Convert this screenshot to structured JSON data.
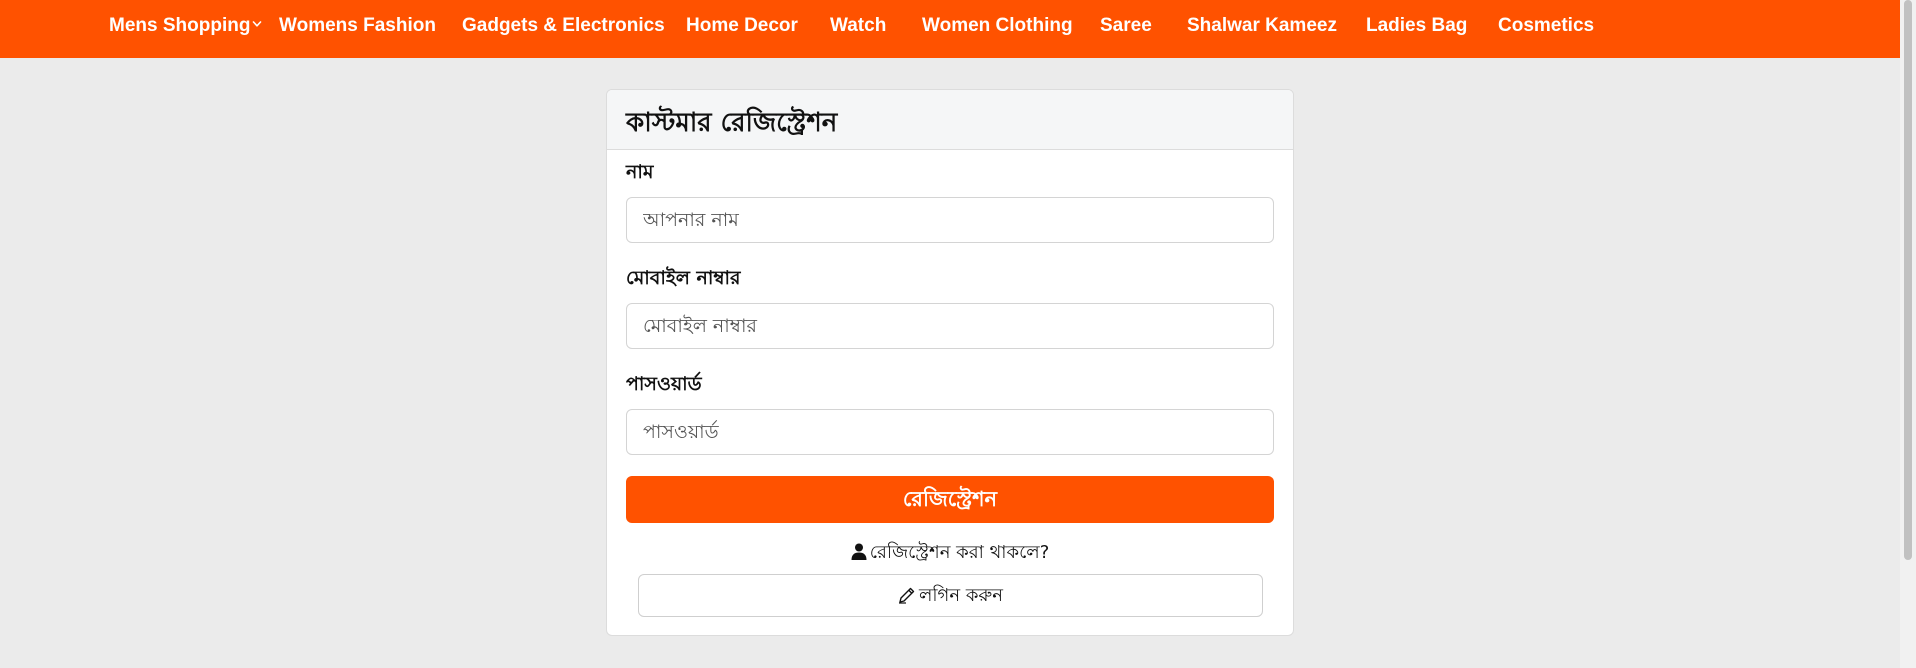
{
  "nav": {
    "items": [
      {
        "label": "Mens Shopping",
        "has_dropdown": true
      },
      {
        "label": "Womens Fashion"
      },
      {
        "label": "Gadgets & Electronics"
      },
      {
        "label": "Home Decor"
      },
      {
        "label": "Watch"
      },
      {
        "label": "Women Clothing"
      },
      {
        "label": "Saree"
      },
      {
        "label": "Shalwar Kameez"
      },
      {
        "label": "Ladies Bag"
      },
      {
        "label": "Cosmetics"
      }
    ]
  },
  "form": {
    "title": "কাস্টমার রেজিস্ট্রেশন",
    "name_label": "নাম",
    "name_placeholder": "আপনার নাম",
    "name_value": "",
    "mobile_label": "মোবাইল নাম্বার",
    "mobile_placeholder": "মোবাইল নাম্বার",
    "mobile_value": "",
    "password_label": "পাসওয়ার্ড",
    "password_placeholder": "পাসওয়ার্ড",
    "password_value": "",
    "submit_label": "রেজিস্ট্রেশন",
    "already_registered_text": "রেজিস্ট্রেশন করা থাকলে?",
    "login_label": "লগিন করুন"
  },
  "icons": {
    "nav_dropdown": "chevron-down-icon",
    "already_registered": "user-icon",
    "login": "pencil-icon"
  },
  "colors": {
    "brand": "#ff5200",
    "page_background": "#ebebeb",
    "card_header": "#f5f6f7"
  }
}
